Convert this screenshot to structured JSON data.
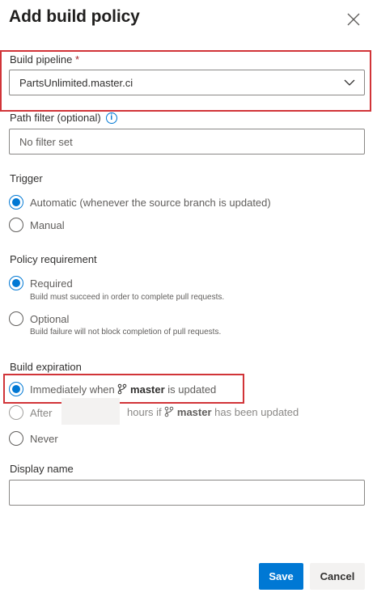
{
  "dialog": {
    "title": "Add build policy",
    "close_icon": "close-icon"
  },
  "build_pipeline": {
    "label": "Build pipeline",
    "required_mark": "*",
    "value": "PartsUnlimited.master.ci",
    "dropdown_icon": "chevron-down-icon"
  },
  "path_filter": {
    "label": "Path filter (optional)",
    "info_icon": "info-icon",
    "placeholder": "No filter set",
    "value": ""
  },
  "trigger": {
    "label": "Trigger",
    "options": [
      {
        "label": "Automatic (whenever the source branch is updated)",
        "selected": true
      },
      {
        "label": "Manual",
        "selected": false
      }
    ]
  },
  "policy_requirement": {
    "label": "Policy requirement",
    "options": [
      {
        "label": "Required",
        "description": "Build must succeed in order to complete pull requests.",
        "selected": true
      },
      {
        "label": "Optional",
        "description": "Build failure will not block completion of pull requests.",
        "selected": false
      }
    ]
  },
  "build_expiration": {
    "label": "Build expiration",
    "branch_icon": "branch-icon",
    "branch": "master",
    "immediately": {
      "prefix": "Immediately when",
      "suffix": "is updated",
      "selected": true
    },
    "after": {
      "label": "After",
      "hours_value": "",
      "middle": "hours if",
      "suffix": "has been updated",
      "selected": false
    },
    "never": {
      "label": "Never",
      "selected": false
    }
  },
  "display_name": {
    "label": "Display name",
    "value": ""
  },
  "footer": {
    "save_label": "Save",
    "cancel_label": "Cancel"
  },
  "colors": {
    "accent": "#0078d4",
    "highlight": "#d13438"
  }
}
